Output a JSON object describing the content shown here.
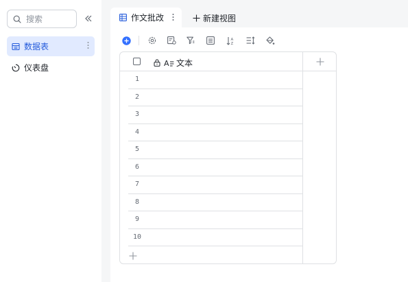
{
  "sidebar": {
    "search_placeholder": "搜索",
    "items": [
      {
        "label": "数据表",
        "icon": "table-icon",
        "active": true
      },
      {
        "label": "仪表盘",
        "icon": "dashboard-icon",
        "active": false
      }
    ]
  },
  "tabs": {
    "active_label": "作文批改",
    "new_view_label": "新建视图"
  },
  "toolbar": {
    "icons": [
      "add-record-icon",
      "settings-icon",
      "field-config-icon",
      "filter-icon",
      "group-icon",
      "sort-icon",
      "row-height-icon",
      "fill-color-icon"
    ]
  },
  "grid": {
    "field_name": "文本",
    "row_numbers": [
      "1",
      "2",
      "3",
      "4",
      "5",
      "6",
      "7",
      "8",
      "9",
      "10"
    ]
  },
  "colors": {
    "accent": "#3370ff",
    "active_bg": "#e1eaff",
    "border": "#dee0e3"
  }
}
